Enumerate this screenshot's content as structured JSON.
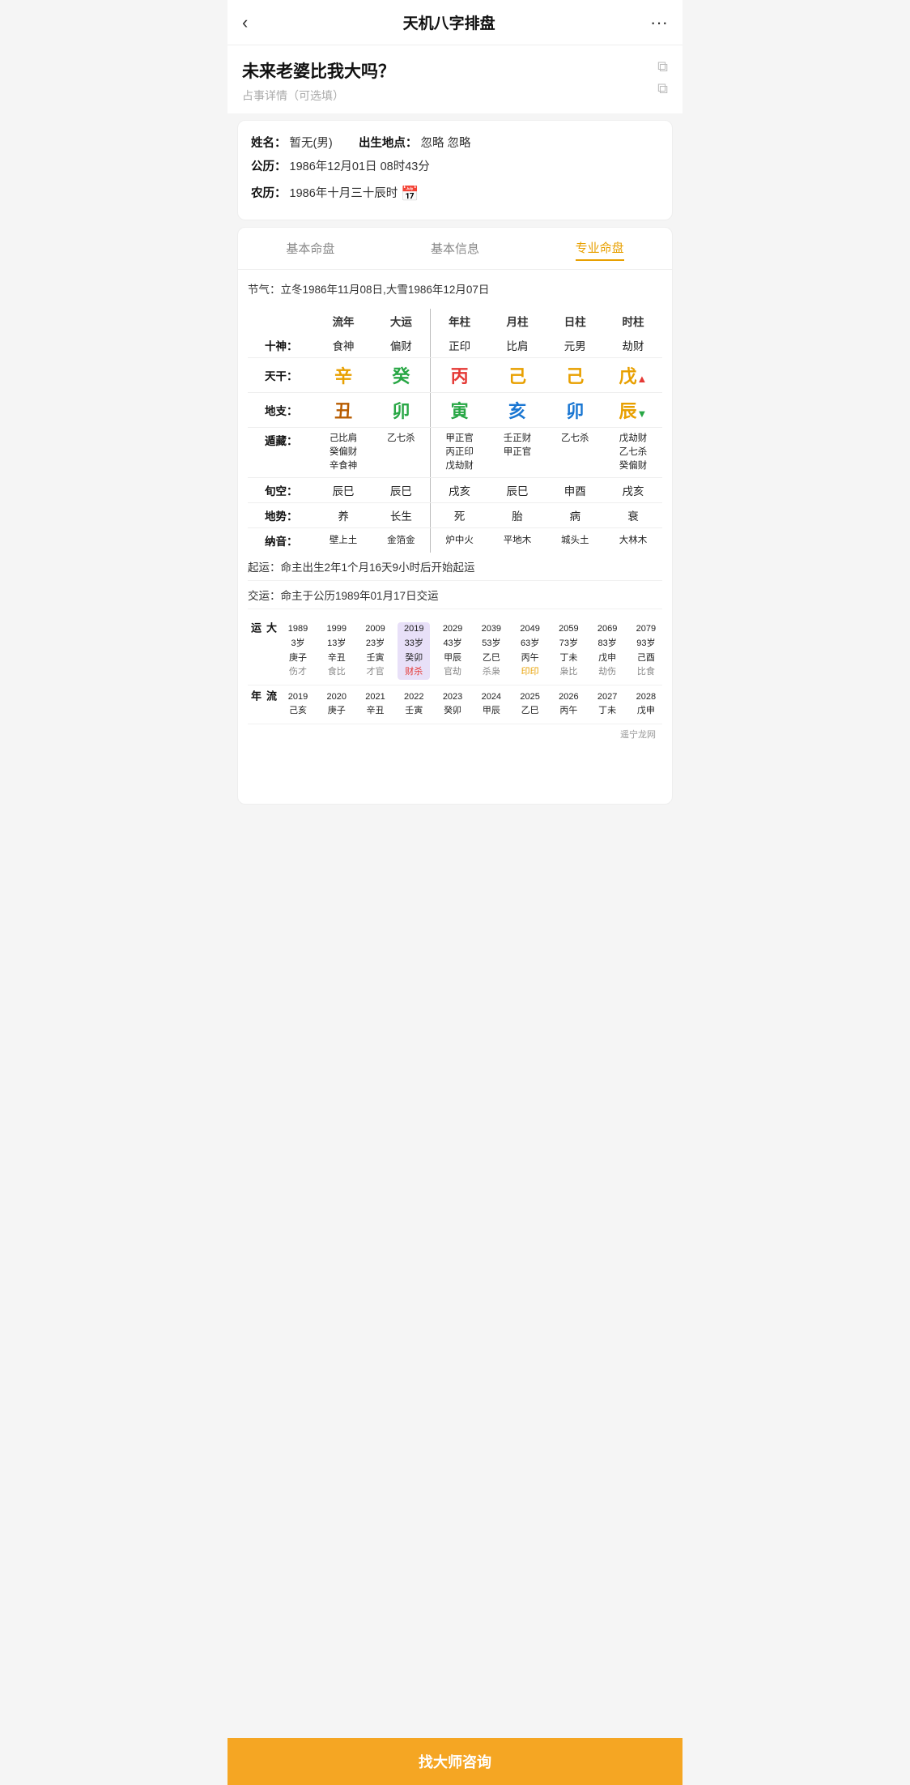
{
  "header": {
    "back_label": "‹",
    "title": "天机八字排盘",
    "more_label": "···"
  },
  "question": {
    "title": "未来老婆比我大吗？",
    "detail_label": "占事详情（可选填）"
  },
  "info": {
    "name_label": "姓名：",
    "name_value": "暂无(男)",
    "birthplace_label": "出生地点：",
    "birthplace_value": "忽略 忽略",
    "solar_label": "公历：",
    "solar_value": "1986年12月01日 08时43分",
    "lunar_label": "农历：",
    "lunar_value": "1986年十月三十辰时",
    "calendar_icon": "📅"
  },
  "tabs": [
    {
      "label": "基本命盘",
      "active": false
    },
    {
      "label": "基本信息",
      "active": false
    },
    {
      "label": "专业命盘",
      "active": true
    }
  ],
  "jieqi": "节气：立冬1986年11月08日,大雪1986年12月07日",
  "table": {
    "col_headers": [
      "流年",
      "大运",
      "年柱",
      "月柱",
      "日柱",
      "时柱"
    ],
    "shishen": {
      "label": "十神：",
      "liunian": "食神",
      "dayun": "偏财",
      "nianzhu": "正印",
      "yuezhu": "比肩",
      "rizhu": "元男",
      "shizhu": "劫财"
    },
    "tiangan": {
      "label": "天干：",
      "liunian_char": "辛",
      "liunian_color": "orange",
      "dayun_char": "癸",
      "dayun_color": "green",
      "nianzhu_char": "丙",
      "nianzhu_color": "red",
      "yuezhu_char": "己",
      "yuezhu_color": "orange",
      "rizhu_char": "己",
      "rizhu_color": "orange",
      "shizhu_char": "戊",
      "shizhu_color": "orange",
      "shizhu_arrow": "▲",
      "shizhu_arrow_color": "red"
    },
    "dizhi": {
      "label": "地支：",
      "liunian_char": "丑",
      "liunian_color": "brown",
      "dayun_char": "卯",
      "dayun_color": "green",
      "nianzhu_char": "寅",
      "nianzhu_color": "green",
      "yuezhu_char": "亥",
      "yuezhu_color": "blue",
      "rizhu_char": "卯",
      "rizhu_color": "blue",
      "shizhu_char": "辰",
      "shizhu_color": "orange",
      "shizhu_arrow": "▼",
      "shizhu_arrow_color": "green"
    },
    "canggan": {
      "label": "遁藏：",
      "liunian": "己比肩\n癸偏财\n辛食神",
      "dayun": "乙七杀",
      "nianzhu": "甲正官\n丙正印\n戊劫财",
      "yuezhu": "壬正财\n甲正官",
      "rizhu": "乙七杀",
      "shizhu": "戊劫财\n乙七杀\n癸偏财"
    },
    "xunkong": {
      "label": "旬空：",
      "liunian": "辰巳",
      "dayun": "辰巳",
      "nianzhu": "戌亥",
      "yuezhu": "辰巳",
      "rizhu": "申酉",
      "shizhu": "戌亥"
    },
    "dishui": {
      "label": "地势：",
      "liunian": "养",
      "dayun": "长生",
      "nianzhu": "死",
      "yuezhu": "胎",
      "rizhu": "病",
      "shizhu": "衰"
    },
    "nayin": {
      "label": "纳音：",
      "liunian": "壁上土",
      "dayun": "金箔金",
      "nianzhu": "炉中火",
      "yuezhu": "平地木",
      "rizhu": "城头土",
      "shizhu": "大林木"
    }
  },
  "qiyun": "起运：命主出生2年1个月16天9小时后开始起运",
  "jiaoyun": "交运：命主于公历1989年01月17日交运",
  "dayun_rows": [
    {
      "year": "1989",
      "age": "3岁",
      "ganzhi": "庚子",
      "shishen": "伤才",
      "shishen_color": "gray"
    },
    {
      "year": "1999",
      "age": "13岁",
      "ganzhi": "辛丑",
      "shishen": "食比",
      "shishen_color": "gray"
    },
    {
      "year": "2009",
      "age": "23岁",
      "ganzhi": "壬寅",
      "shishen": "才官",
      "shishen_color": "gray"
    },
    {
      "year": "2019",
      "age": "33岁",
      "ganzhi": "癸卯",
      "shishen": "财杀",
      "shishen_color": "red",
      "highlight": true
    },
    {
      "year": "2029",
      "age": "43岁",
      "ganzhi": "甲辰",
      "shishen": "官劫",
      "shishen_color": "gray"
    },
    {
      "year": "2039",
      "age": "53岁",
      "ganzhi": "乙巳",
      "shishen": "杀枭",
      "shishen_color": "gray"
    },
    {
      "year": "2049",
      "age": "63岁",
      "ganzhi": "丙午",
      "shishen": "印印",
      "shishen_color": "orange"
    },
    {
      "year": "2059",
      "age": "73岁",
      "ganzhi": "丁未",
      "shishen": "枭比",
      "shishen_color": "gray"
    },
    {
      "year": "2069",
      "age": "83岁",
      "ganzhi": "戊申",
      "shishen": "劫伤",
      "shishen_color": "gray"
    },
    {
      "year": "2079",
      "age": "93岁",
      "ganzhi": "己酉",
      "shishen": "比食",
      "shishen_color": "gray"
    }
  ],
  "liuyun_row": {
    "years": [
      "2019",
      "2020",
      "2021",
      "2022",
      "2023",
      "2024",
      "2025",
      "2026",
      "2027",
      "2028"
    ],
    "ganzhi": [
      "己亥",
      "庚子",
      "辛丑",
      "壬寅",
      "癸卯",
      "甲辰",
      "乙巳",
      "丙午",
      "丁未",
      "戊申"
    ]
  },
  "bottom_btn": "找大师咨询",
  "watermark": "遥宁龙网"
}
